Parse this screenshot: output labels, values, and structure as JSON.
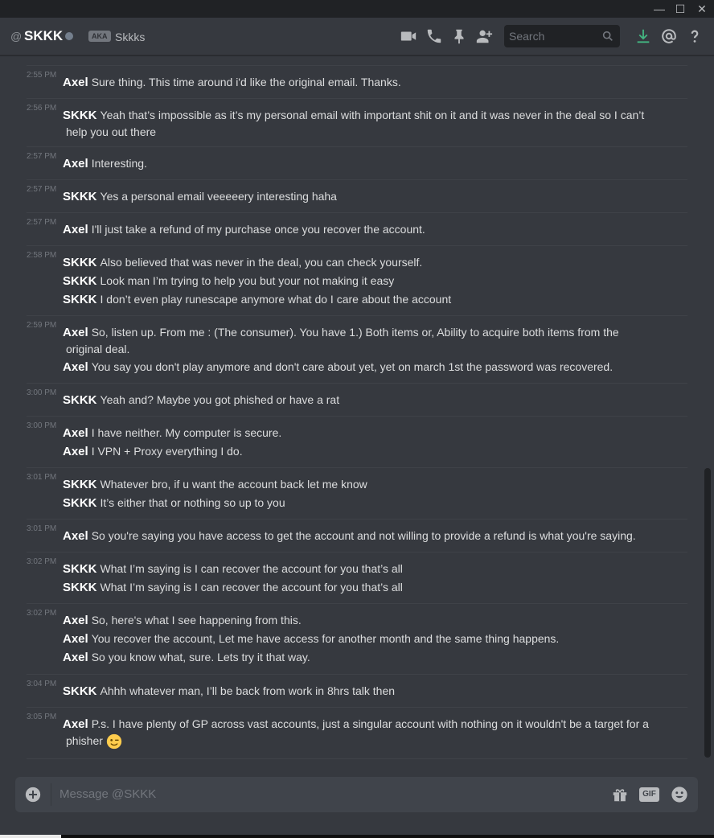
{
  "window": {
    "minimize": "—",
    "maximize": "☐",
    "close": "✕"
  },
  "header": {
    "at_symbol": "@",
    "username": "SKKK",
    "aka_label": "AKA",
    "nickname": "Skkks",
    "search_placeholder": "Search"
  },
  "messages": [
    {
      "time": "2:55 PM",
      "lines": [
        {
          "author": "Axel",
          "text": "Sure thing. This time around i'd like the original email. Thanks."
        }
      ]
    },
    {
      "time": "2:56 PM",
      "lines": [
        {
          "author": "SKKK",
          "text": "Yeah that’s impossible as it’s my personal email with important shit on it and it was never in the deal so I can’t",
          "cont": "help you out there"
        }
      ]
    },
    {
      "time": "2:57 PM",
      "lines": [
        {
          "author": "Axel",
          "text": "Interesting."
        }
      ]
    },
    {
      "time": "2:57 PM",
      "lines": [
        {
          "author": "SKKK",
          "text": "Yes a personal email veeeeery interesting haha"
        }
      ]
    },
    {
      "time": "2:57 PM",
      "lines": [
        {
          "author": "Axel",
          "text": "I'll just take a refund of my purchase once you recover the account."
        }
      ]
    },
    {
      "time": "2:58 PM",
      "lines": [
        {
          "author": "SKKK",
          "text": "Also believed that was never in the deal, you can check yourself."
        },
        {
          "author": "SKKK",
          "text": "Look man I’m trying to help you but your not making it easy"
        },
        {
          "author": "SKKK",
          "text": "I don’t even play runescape anymore what do I care about the account"
        }
      ]
    },
    {
      "time": "2:59 PM",
      "lines": [
        {
          "author": "Axel",
          "text": "So, listen up. From me : (The consumer). You have 1.) Both items or, Ability to acquire both items from the",
          "cont": "original deal."
        },
        {
          "author": "Axel",
          "text": "You say you don't play anymore and don't care about yet, yet on march 1st the password was recovered."
        }
      ]
    },
    {
      "time": "3:00 PM",
      "lines": [
        {
          "author": "SKKK",
          "text": "Yeah and? Maybe you got phished or have a rat"
        }
      ]
    },
    {
      "time": "3:00 PM",
      "lines": [
        {
          "author": "Axel",
          "text": "I have neither. My computer is secure."
        },
        {
          "author": "Axel",
          "text": "I VPN + Proxy everything I do."
        }
      ]
    },
    {
      "time": "3:01 PM",
      "lines": [
        {
          "author": "SKKK",
          "text": "Whatever bro, if u want the account back let me know"
        },
        {
          "author": "SKKK",
          "text": "It’s either that or nothing so up to you"
        }
      ]
    },
    {
      "time": "3:01 PM",
      "lines": [
        {
          "author": "Axel",
          "text": "So you're saying you have access to get the account and not willing to provide a refund is what you're saying."
        }
      ]
    },
    {
      "time": "3:02 PM",
      "lines": [
        {
          "author": "SKKK",
          "text": "What I’m saying is I can recover the account for you that’s all"
        },
        {
          "author": "SKKK",
          "text": "What I’m saying is I can recover the account for you that’s all"
        }
      ]
    },
    {
      "time": "3:02 PM",
      "lines": [
        {
          "author": "Axel",
          "text": "So, here's what I see happening from this."
        },
        {
          "author": "Axel",
          "text": "You recover the account, Let me have access for another month and the same thing happens."
        },
        {
          "author": "Axel",
          "text": "So you know what, sure. Lets try it that way."
        }
      ]
    },
    {
      "time": "3:04 PM",
      "lines": [
        {
          "author": "SKKK",
          "text": "Ahhh whatever man, I’ll be back from work in 8hrs talk then"
        }
      ]
    },
    {
      "time": "3:05 PM",
      "lines": [
        {
          "author": "Axel",
          "text": "P.s. I have plenty of GP across vast accounts, just a singular account with nothing on it wouldn't be a target for a",
          "cont": "phisher",
          "emoji": "winking-face"
        }
      ]
    }
  ],
  "composer": {
    "placeholder": "Message @SKKK",
    "gif_label": "GIF"
  },
  "colors": {
    "background": "#36393f",
    "header": "#36393f",
    "input": "#40444b",
    "titlebar": "#202225",
    "accent_download": "#43b581"
  }
}
